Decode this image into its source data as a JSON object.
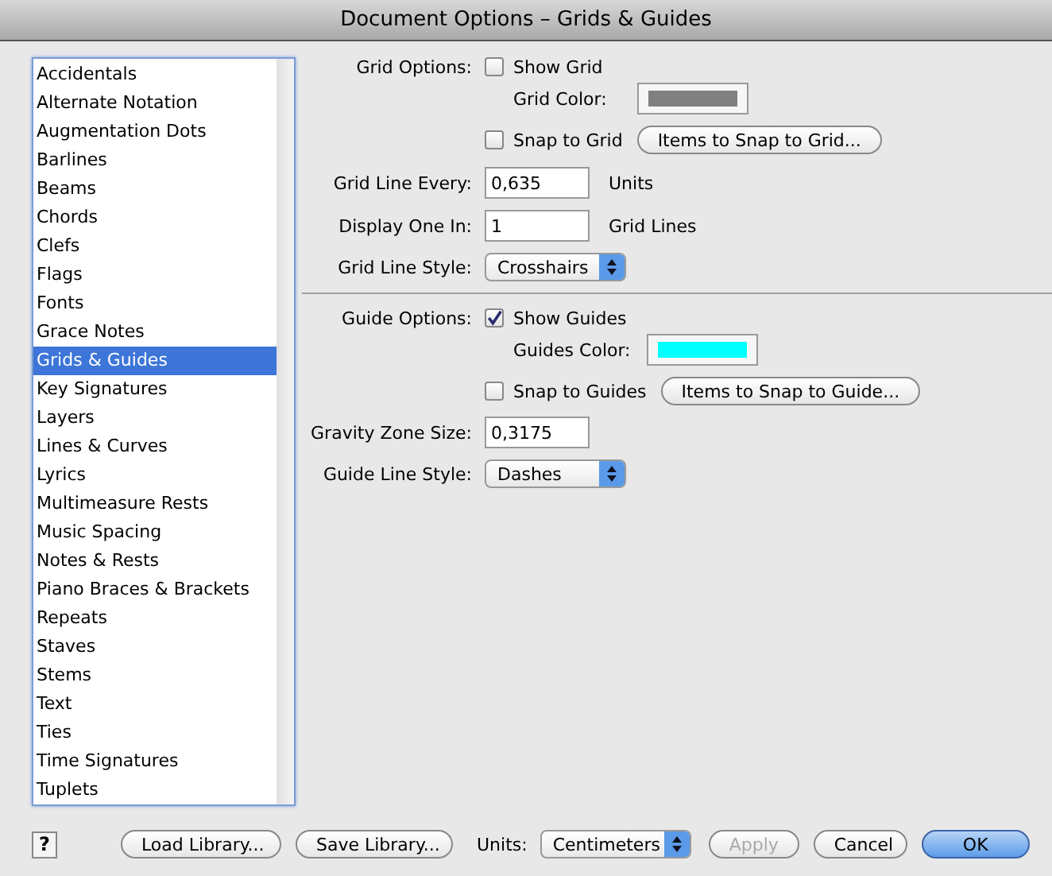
{
  "window": {
    "title": "Document Options – Grids & Guides"
  },
  "sidebar": {
    "items": [
      {
        "label": "Accidentals",
        "selected": false
      },
      {
        "label": "Alternate Notation",
        "selected": false
      },
      {
        "label": "Augmentation Dots",
        "selected": false
      },
      {
        "label": "Barlines",
        "selected": false
      },
      {
        "label": "Beams",
        "selected": false
      },
      {
        "label": "Chords",
        "selected": false
      },
      {
        "label": "Clefs",
        "selected": false
      },
      {
        "label": "Flags",
        "selected": false
      },
      {
        "label": "Fonts",
        "selected": false
      },
      {
        "label": "Grace Notes",
        "selected": false
      },
      {
        "label": "Grids & Guides",
        "selected": true
      },
      {
        "label": "Key Signatures",
        "selected": false
      },
      {
        "label": "Layers",
        "selected": false
      },
      {
        "label": "Lines & Curves",
        "selected": false
      },
      {
        "label": "Lyrics",
        "selected": false
      },
      {
        "label": "Multimeasure Rests",
        "selected": false
      },
      {
        "label": "Music Spacing",
        "selected": false
      },
      {
        "label": "Notes & Rests",
        "selected": false
      },
      {
        "label": "Piano Braces & Brackets",
        "selected": false
      },
      {
        "label": "Repeats",
        "selected": false
      },
      {
        "label": "Staves",
        "selected": false
      },
      {
        "label": "Stems",
        "selected": false
      },
      {
        "label": "Text",
        "selected": false
      },
      {
        "label": "Ties",
        "selected": false
      },
      {
        "label": "Time Signatures",
        "selected": false
      },
      {
        "label": "Tuplets",
        "selected": false
      }
    ]
  },
  "grid": {
    "label": "Grid Options:",
    "show": {
      "label": "Show Grid",
      "checked": false
    },
    "color": {
      "label": "Grid Color:",
      "color": "#808080"
    },
    "snap": {
      "label": "Snap to Grid",
      "checked": false
    },
    "snap_button": "Items to Snap to Grid...",
    "line_every": {
      "label": "Grid Line Every:",
      "value": "0,635",
      "unit": "Units"
    },
    "display_one_in": {
      "label": "Display One In:",
      "value": "1",
      "unit": "Grid Lines"
    },
    "line_style": {
      "label": "Grid Line Style:",
      "value": "Crosshairs"
    }
  },
  "guides": {
    "label": "Guide Options:",
    "show": {
      "label": "Show Guides",
      "checked": true
    },
    "color": {
      "label": "Guides Color:",
      "color": "#00ffff"
    },
    "snap": {
      "label": "Snap to Guides",
      "checked": false
    },
    "snap_button": "Items to Snap to Guide...",
    "gravity": {
      "label": "Gravity Zone Size:",
      "value": "0,3175"
    },
    "line_style": {
      "label": "Guide Line Style:",
      "value": "Dashes"
    }
  },
  "footer": {
    "help": "?",
    "load": "Load Library...",
    "save": "Save Library...",
    "units": {
      "label": "Units:",
      "value": "Centimeters"
    },
    "buttons": [
      {
        "label": "Apply",
        "disabled": true,
        "default": false
      },
      {
        "label": "Cancel",
        "disabled": false,
        "default": false
      },
      {
        "label": "OK",
        "disabled": false,
        "default": true
      }
    ]
  }
}
